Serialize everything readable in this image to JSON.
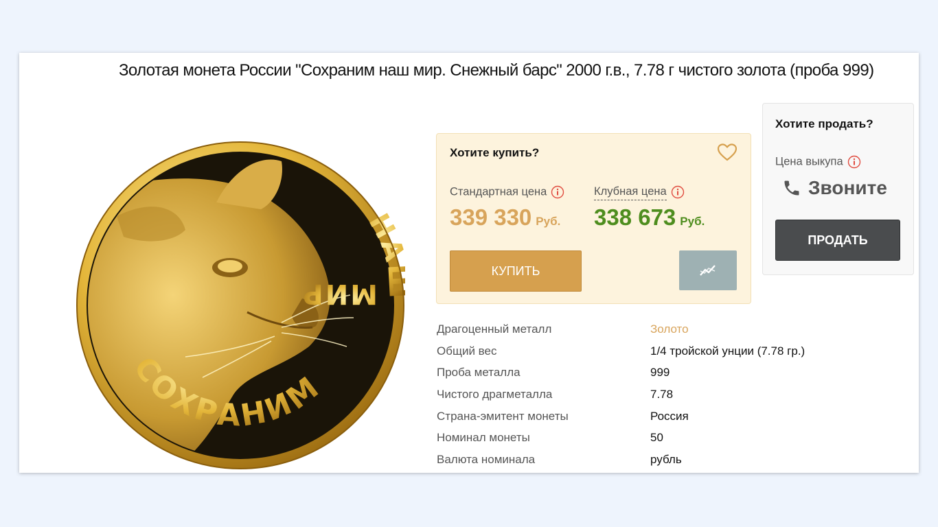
{
  "product": {
    "title": "Золотая монета России \"Сохраним наш мир. Снежный барс\" 2000 г.в., 7.78 г чистого золота (проба 999)"
  },
  "coin_image": {
    "inscription_top": "МИР",
    "inscription_side": "НАШ",
    "inscription_bottom": "СОХРАНИМ",
    "icon": "snow-leopard-coin-image"
  },
  "buy": {
    "title": "Хотите купить?",
    "standard_price_label": "Стандартная цена",
    "standard_price": "339 330",
    "club_price_label": "Клубная цена",
    "club_price": "338 673",
    "currency": "Руб.",
    "buy_button": "КУПИТЬ",
    "icons": [
      "heart-icon",
      "info-icon",
      "chart-icon"
    ]
  },
  "sell": {
    "title": "Хотите продать?",
    "buyback_label": "Цена выкупа",
    "call_text": "Звоните",
    "sell_button": "ПРОДАТЬ",
    "icons": [
      "phone-icon",
      "info-icon"
    ]
  },
  "specs": [
    {
      "label": "Драгоценный металл",
      "value": "Золото"
    },
    {
      "label": "Общий вес",
      "value": "1/4 тройской унции (7.78 гр.)"
    },
    {
      "label": "Проба металла",
      "value": "999"
    },
    {
      "label": "Чистого драгметалла",
      "value": "7.78"
    },
    {
      "label": "Страна-эмитент монеты",
      "value": "Россия"
    },
    {
      "label": "Номинал монеты",
      "value": "50"
    },
    {
      "label": "Валюта номинала",
      "value": "рубль"
    }
  ],
  "colors": {
    "page_background": "#eef4fd",
    "gold_accent": "#d6a04e",
    "club_green": "#4e8d1e",
    "buy_box_background": "#fdf3dd",
    "sell_button": "#4a4c4e",
    "info_red": "#e04b3f"
  }
}
